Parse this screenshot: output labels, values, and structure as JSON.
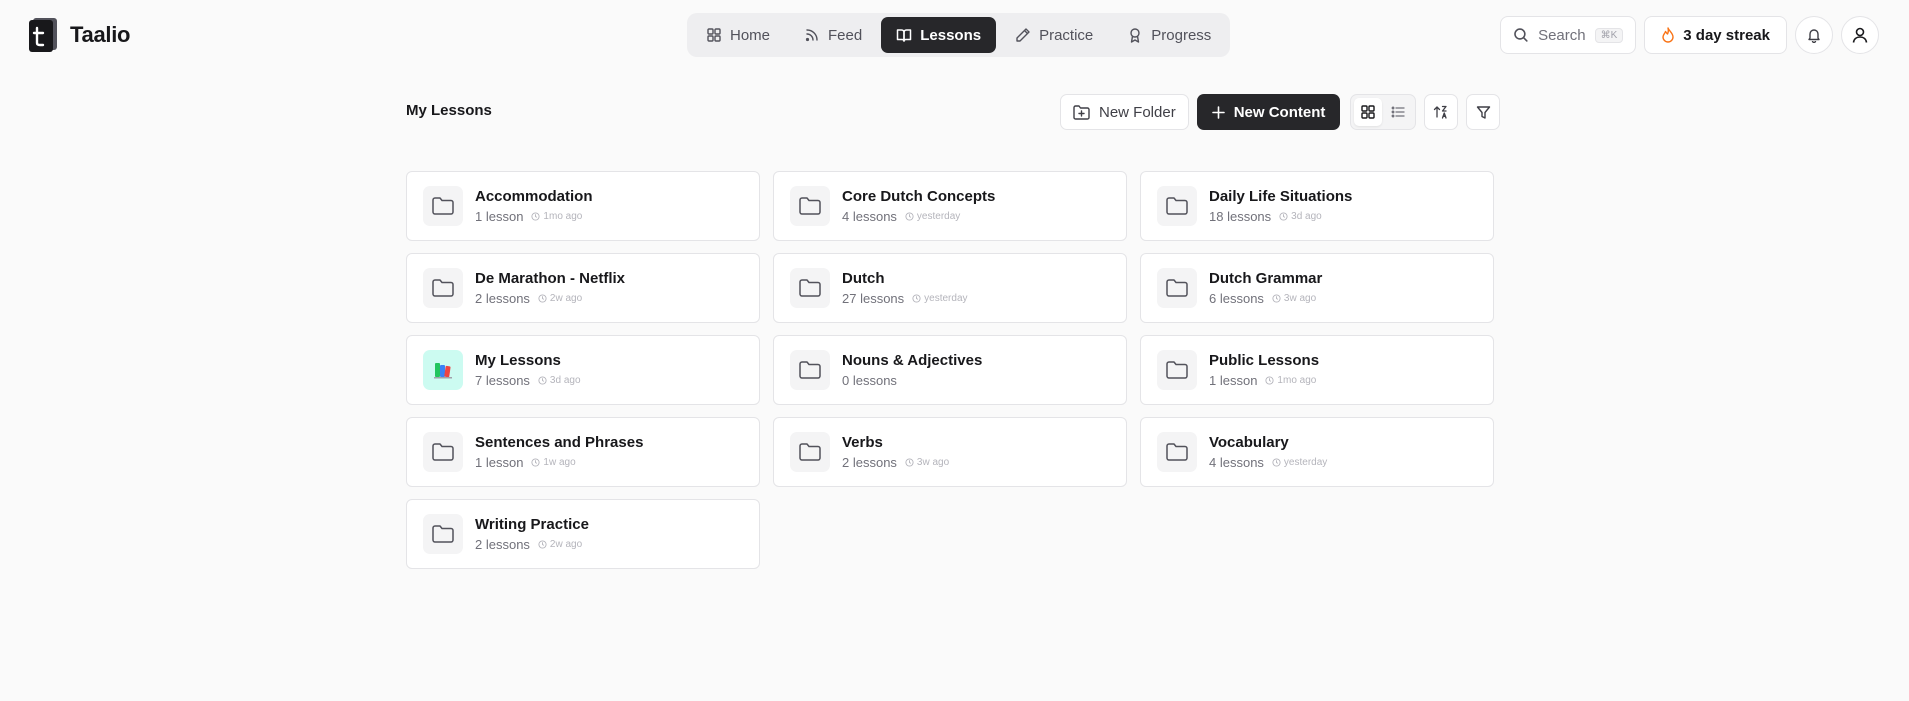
{
  "app": {
    "name": "Taalio"
  },
  "nav": {
    "tabs": [
      {
        "label": "Home",
        "icon": "grid-icon"
      },
      {
        "label": "Feed",
        "icon": "rss-icon"
      },
      {
        "label": "Lessons",
        "icon": "book-icon",
        "active": true
      },
      {
        "label": "Practice",
        "icon": "pencil-icon"
      },
      {
        "label": "Progress",
        "icon": "award-icon"
      }
    ]
  },
  "top_right": {
    "search_label": "Search",
    "search_shortcut": "⌘K",
    "streak_label": "3 day streak"
  },
  "page": {
    "title": "My Lessons",
    "new_folder_label": "New Folder",
    "new_content_label": "New Content"
  },
  "folders": [
    {
      "name": "Accommodation",
      "count": "1 lesson",
      "time": "1mo ago"
    },
    {
      "name": "Core Dutch Concepts",
      "count": "4 lessons",
      "time": "yesterday"
    },
    {
      "name": "Daily Life Situations",
      "count": "18 lessons",
      "time": "3d ago"
    },
    {
      "name": "De Marathon - Netflix",
      "count": "2 lessons",
      "time": "2w ago"
    },
    {
      "name": "Dutch",
      "count": "27 lessons",
      "time": "yesterday"
    },
    {
      "name": "Dutch Grammar",
      "count": "6 lessons",
      "time": "3w ago"
    },
    {
      "name": "My Lessons",
      "count": "7 lessons",
      "time": "3d ago",
      "special": true
    },
    {
      "name": "Nouns & Adjectives",
      "count": "0 lessons",
      "time": ""
    },
    {
      "name": "Public Lessons",
      "count": "1 lesson",
      "time": "1mo ago"
    },
    {
      "name": "Sentences and Phrases",
      "count": "1 lesson",
      "time": "1w ago"
    },
    {
      "name": "Verbs",
      "count": "2 lessons",
      "time": "3w ago"
    },
    {
      "name": "Vocabulary",
      "count": "4 lessons",
      "time": "yesterday"
    },
    {
      "name": "Writing Practice",
      "count": "2 lessons",
      "time": "2w ago"
    }
  ],
  "colors": {
    "accent_dark": "#27272a",
    "background": "#fafafa",
    "border": "#e4e4e7",
    "streak_flame": "#f97316",
    "special_folder_bg": "#ccfbf1"
  }
}
